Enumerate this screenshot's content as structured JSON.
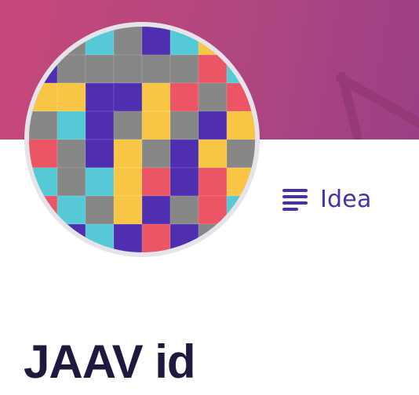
{
  "banner": {
    "color_start": "#c8487a",
    "color_end": "#9c3f86"
  },
  "avatar": {
    "icon": "pixel-mosaic-avatar",
    "ring_color": "#e6e4ea",
    "palette": {
      "teal": "#56c9d6",
      "gray": "#878787",
      "purple": "#4f2fb0",
      "yellow": "#f8c644",
      "red": "#ec5565"
    }
  },
  "category": {
    "icon": "list-lines-icon",
    "label": "Idea",
    "color": "#4d2fa7"
  },
  "title": {
    "text": "JAAV id",
    "color": "#1f1a3d"
  }
}
